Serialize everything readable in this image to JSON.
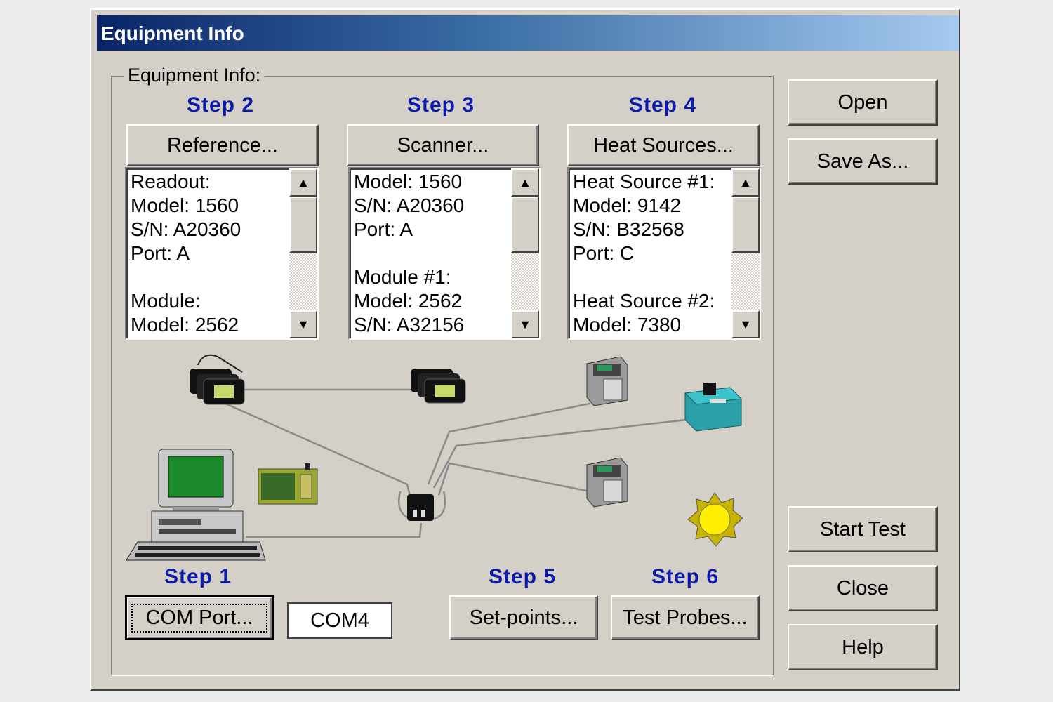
{
  "window": {
    "title": "Equipment Info"
  },
  "group": {
    "label": "Equipment Info:"
  },
  "steps": {
    "step1": "Step 1",
    "step2": "Step 2",
    "step3": "Step 3",
    "step4": "Step 4",
    "step5": "Step 5",
    "step6": "Step 6"
  },
  "buttons": {
    "reference": "Reference...",
    "scanner": "Scanner...",
    "heat_sources": "Heat Sources...",
    "com_port": "COM Port...",
    "set_points": "Set-points...",
    "test_probes": "Test Probes...",
    "open": "Open",
    "save_as": "Save As...",
    "start_test": "Start Test",
    "close": "Close",
    "help": "Help"
  },
  "com_port_value": "COM4",
  "lists": {
    "reference": "Readout:\nModel: 1560\nS/N: A20360\nPort: A\n\nModule:\nModel: 2562",
    "scanner": "Model: 1560\nS/N: A20360\nPort: A\n\nModule #1:\nModel: 2562\nS/N: A32156",
    "heat_sources": "Heat Source #1:\nModel: 9142\nS/N: B32568\nPort: C\n\nHeat Source #2:\nModel: 7380"
  },
  "icons": {
    "scroll_up": "▲",
    "scroll_down": "▼"
  },
  "colors": {
    "step_label": "#0b1ba8",
    "title_start": "#0a246a",
    "title_end": "#a6caf0"
  }
}
